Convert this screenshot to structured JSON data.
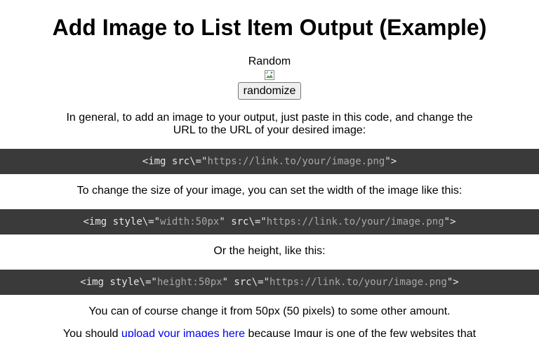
{
  "title": "Add Image to List Item Output (Example)",
  "random_label": "Random",
  "randomize_button": "randomize",
  "intro_text": "In general, to add an image to your output, just paste in this code, and change the URL to the URL of your desired image:",
  "code1": {
    "prefix": "<img src\\=\"",
    "url": "https://link.to/your/image.png",
    "suffix": "\">"
  },
  "size_text": "To change the size of your image, you can set the width of the image like this:",
  "code2": {
    "prefix": "<img style\\=\"",
    "style": "width:50px",
    "middle": "\" src\\=\"",
    "url": "https://link.to/your/image.png",
    "suffix": "\">"
  },
  "height_text": "Or the height, like this:",
  "code3": {
    "prefix": "<img style\\=\"",
    "style": "height:50px",
    "middle": "\" src\\=\"",
    "url": "https://link.to/your/image.png",
    "suffix": "\">"
  },
  "change_text": "You can of course change it from 50px (50 pixels) to some other amount.",
  "upload": {
    "before": "You should ",
    "link": "upload your images here",
    "after": " because Imgur is one of the few websites that"
  },
  "colors": {
    "code_background": "#3a3a3a",
    "link": "#0000ee"
  },
  "icons": {
    "broken_image": "broken-image-icon"
  }
}
